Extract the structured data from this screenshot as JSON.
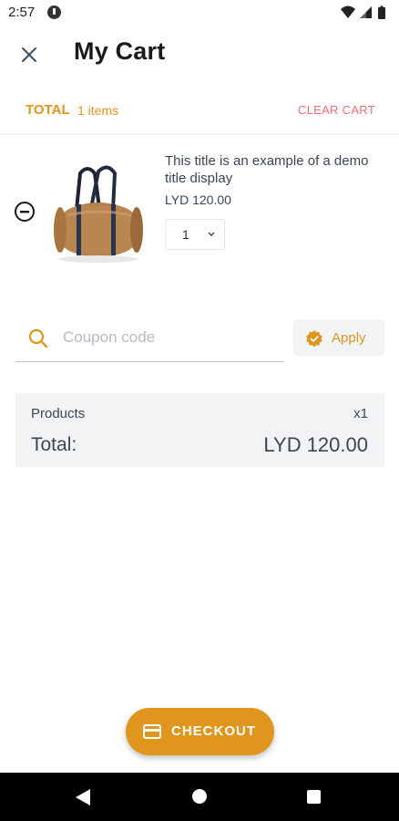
{
  "status_bar": {
    "time": "2:57",
    "icons": [
      "app-notification-icon",
      "wifi-icon",
      "signal-icon",
      "battery-icon"
    ]
  },
  "app_bar": {
    "close_icon": "close-icon",
    "title": "My Cart"
  },
  "cart_summary_row": {
    "total_label": "TOTAL",
    "items_count": "1 items",
    "clear_label": "CLEAR CART"
  },
  "cart_items": [
    {
      "remove_icon": "remove-circle-icon",
      "image": "duffel-bag",
      "title": "This title is an example of a demo title display",
      "price": "LYD 120.00",
      "quantity": "1"
    }
  ],
  "coupon": {
    "icon": "search-icon",
    "placeholder": "Coupon code",
    "value": "",
    "apply_icon": "verified-badge-icon",
    "apply_label": "Apply"
  },
  "summary": {
    "products_label": "Products",
    "products_count": "x1",
    "total_label": "Total:",
    "total_value": "LYD 120.00"
  },
  "checkout": {
    "icon": "credit-card-icon",
    "label": "CHECKOUT"
  },
  "nav_bar": {
    "icons": [
      "back-icon",
      "home-icon",
      "recents-icon"
    ]
  },
  "colors": {
    "accent": "#e0961d",
    "clear_cart": "#e8707a",
    "text": "#3b4653",
    "card_bg": "#f1f3f5"
  }
}
